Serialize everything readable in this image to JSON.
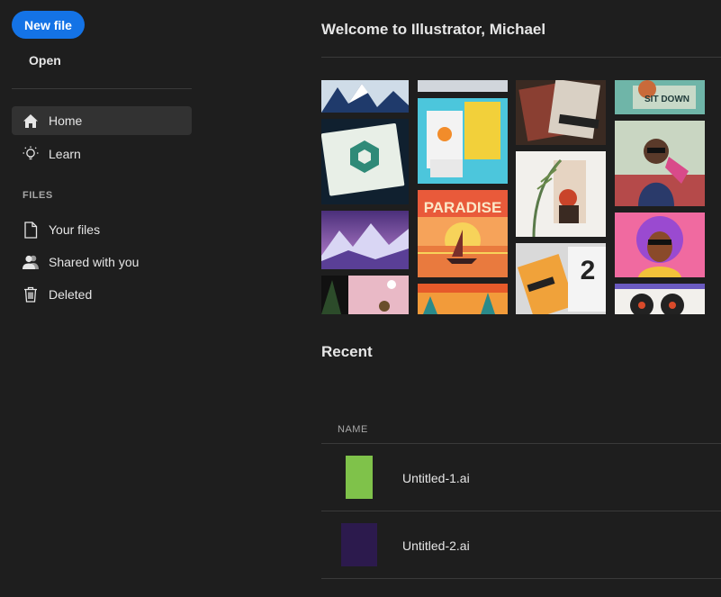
{
  "sidebar": {
    "new_file_label": "New file",
    "open_label": "Open",
    "nav": [
      {
        "label": "Home",
        "icon": "home-icon",
        "active": true
      },
      {
        "label": "Learn",
        "icon": "lightbulb-icon",
        "active": false
      }
    ],
    "files_section_label": "FILES",
    "files": [
      {
        "label": "Your files",
        "icon": "document-icon"
      },
      {
        "label": "Shared with you",
        "icon": "shared-users-icon"
      },
      {
        "label": "Deleted",
        "icon": "trash-icon"
      }
    ]
  },
  "main": {
    "welcome_text": "Welcome to Illustrator, Michael",
    "gallery_texts": {
      "paradise": "PARADISE",
      "sitdown": "SIT DOWN"
    },
    "recent_title": "Recent",
    "table_header_name": "NAME",
    "recent_files": [
      {
        "name": "Untitled-1.ai",
        "thumb_color": "#7fc24a"
      },
      {
        "name": "Untitled-2.ai",
        "thumb_color": "#2c1a4d"
      }
    ]
  },
  "colors": {
    "accent": "#1473e6",
    "background": "#1e1e1e",
    "active_nav": "#323232"
  }
}
